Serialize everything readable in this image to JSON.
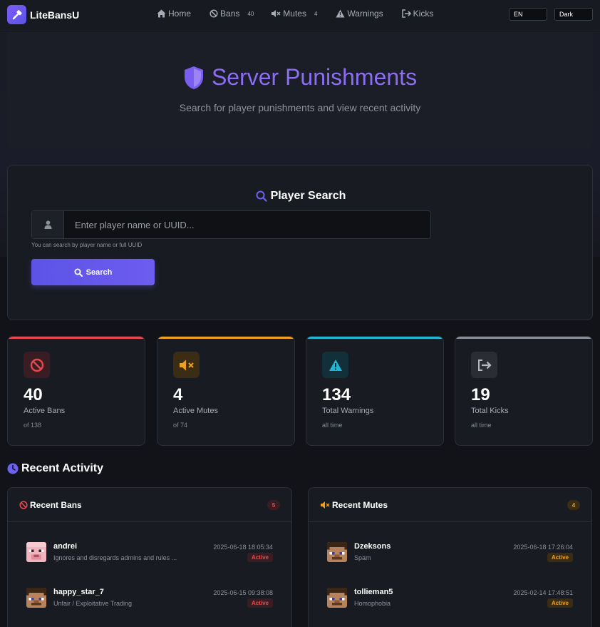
{
  "brand": {
    "name": "LiteBansU"
  },
  "nav": {
    "home": "Home",
    "bans": "Bans",
    "bans_count": "40",
    "mutes": "Mutes",
    "mutes_count": "4",
    "warnings": "Warnings",
    "kicks": "Kicks"
  },
  "controls": {
    "language": "EN",
    "theme": "Dark"
  },
  "hero": {
    "title": "Server Punishments",
    "subtitle": "Search for player punishments and view recent activity"
  },
  "search": {
    "title": "Player Search",
    "placeholder": "Enter player name or UUID...",
    "hint": "You can search by player name or full UUID",
    "button": "Search"
  },
  "stats": [
    {
      "value": "40",
      "label": "Active Bans",
      "sub": "of 138",
      "color": "#e5484d"
    },
    {
      "value": "4",
      "label": "Active Mutes",
      "sub": "of 74",
      "color": "#f0a020"
    },
    {
      "value": "134",
      "label": "Total Warnings",
      "sub": "all time",
      "color": "#1fb6d4"
    },
    {
      "value": "19",
      "label": "Total Kicks",
      "sub": "all time",
      "color": "#8a8e98"
    }
  ],
  "recent": {
    "title": "Recent Activity",
    "bans": {
      "title": "Recent Bans",
      "count": "5",
      "entries": [
        {
          "name": "andrei",
          "reason": "Ignores and disregards admins and rules ...",
          "date": "2025-06-18 18:05:34",
          "status": "Active"
        },
        {
          "name": "happy_star_7",
          "reason": "Unfair / Exploitative Trading",
          "date": "2025-06-15 09:38:08",
          "status": "Active"
        }
      ]
    },
    "mutes": {
      "title": "Recent Mutes",
      "count": "4",
      "entries": [
        {
          "name": "Dzeksons",
          "reason": "Spam",
          "date": "2025-06-18 17:26:04",
          "status": "Active"
        },
        {
          "name": "tollieman5",
          "reason": "Homophobia",
          "date": "2025-02-14 17:48:51",
          "status": "Active"
        }
      ]
    }
  }
}
